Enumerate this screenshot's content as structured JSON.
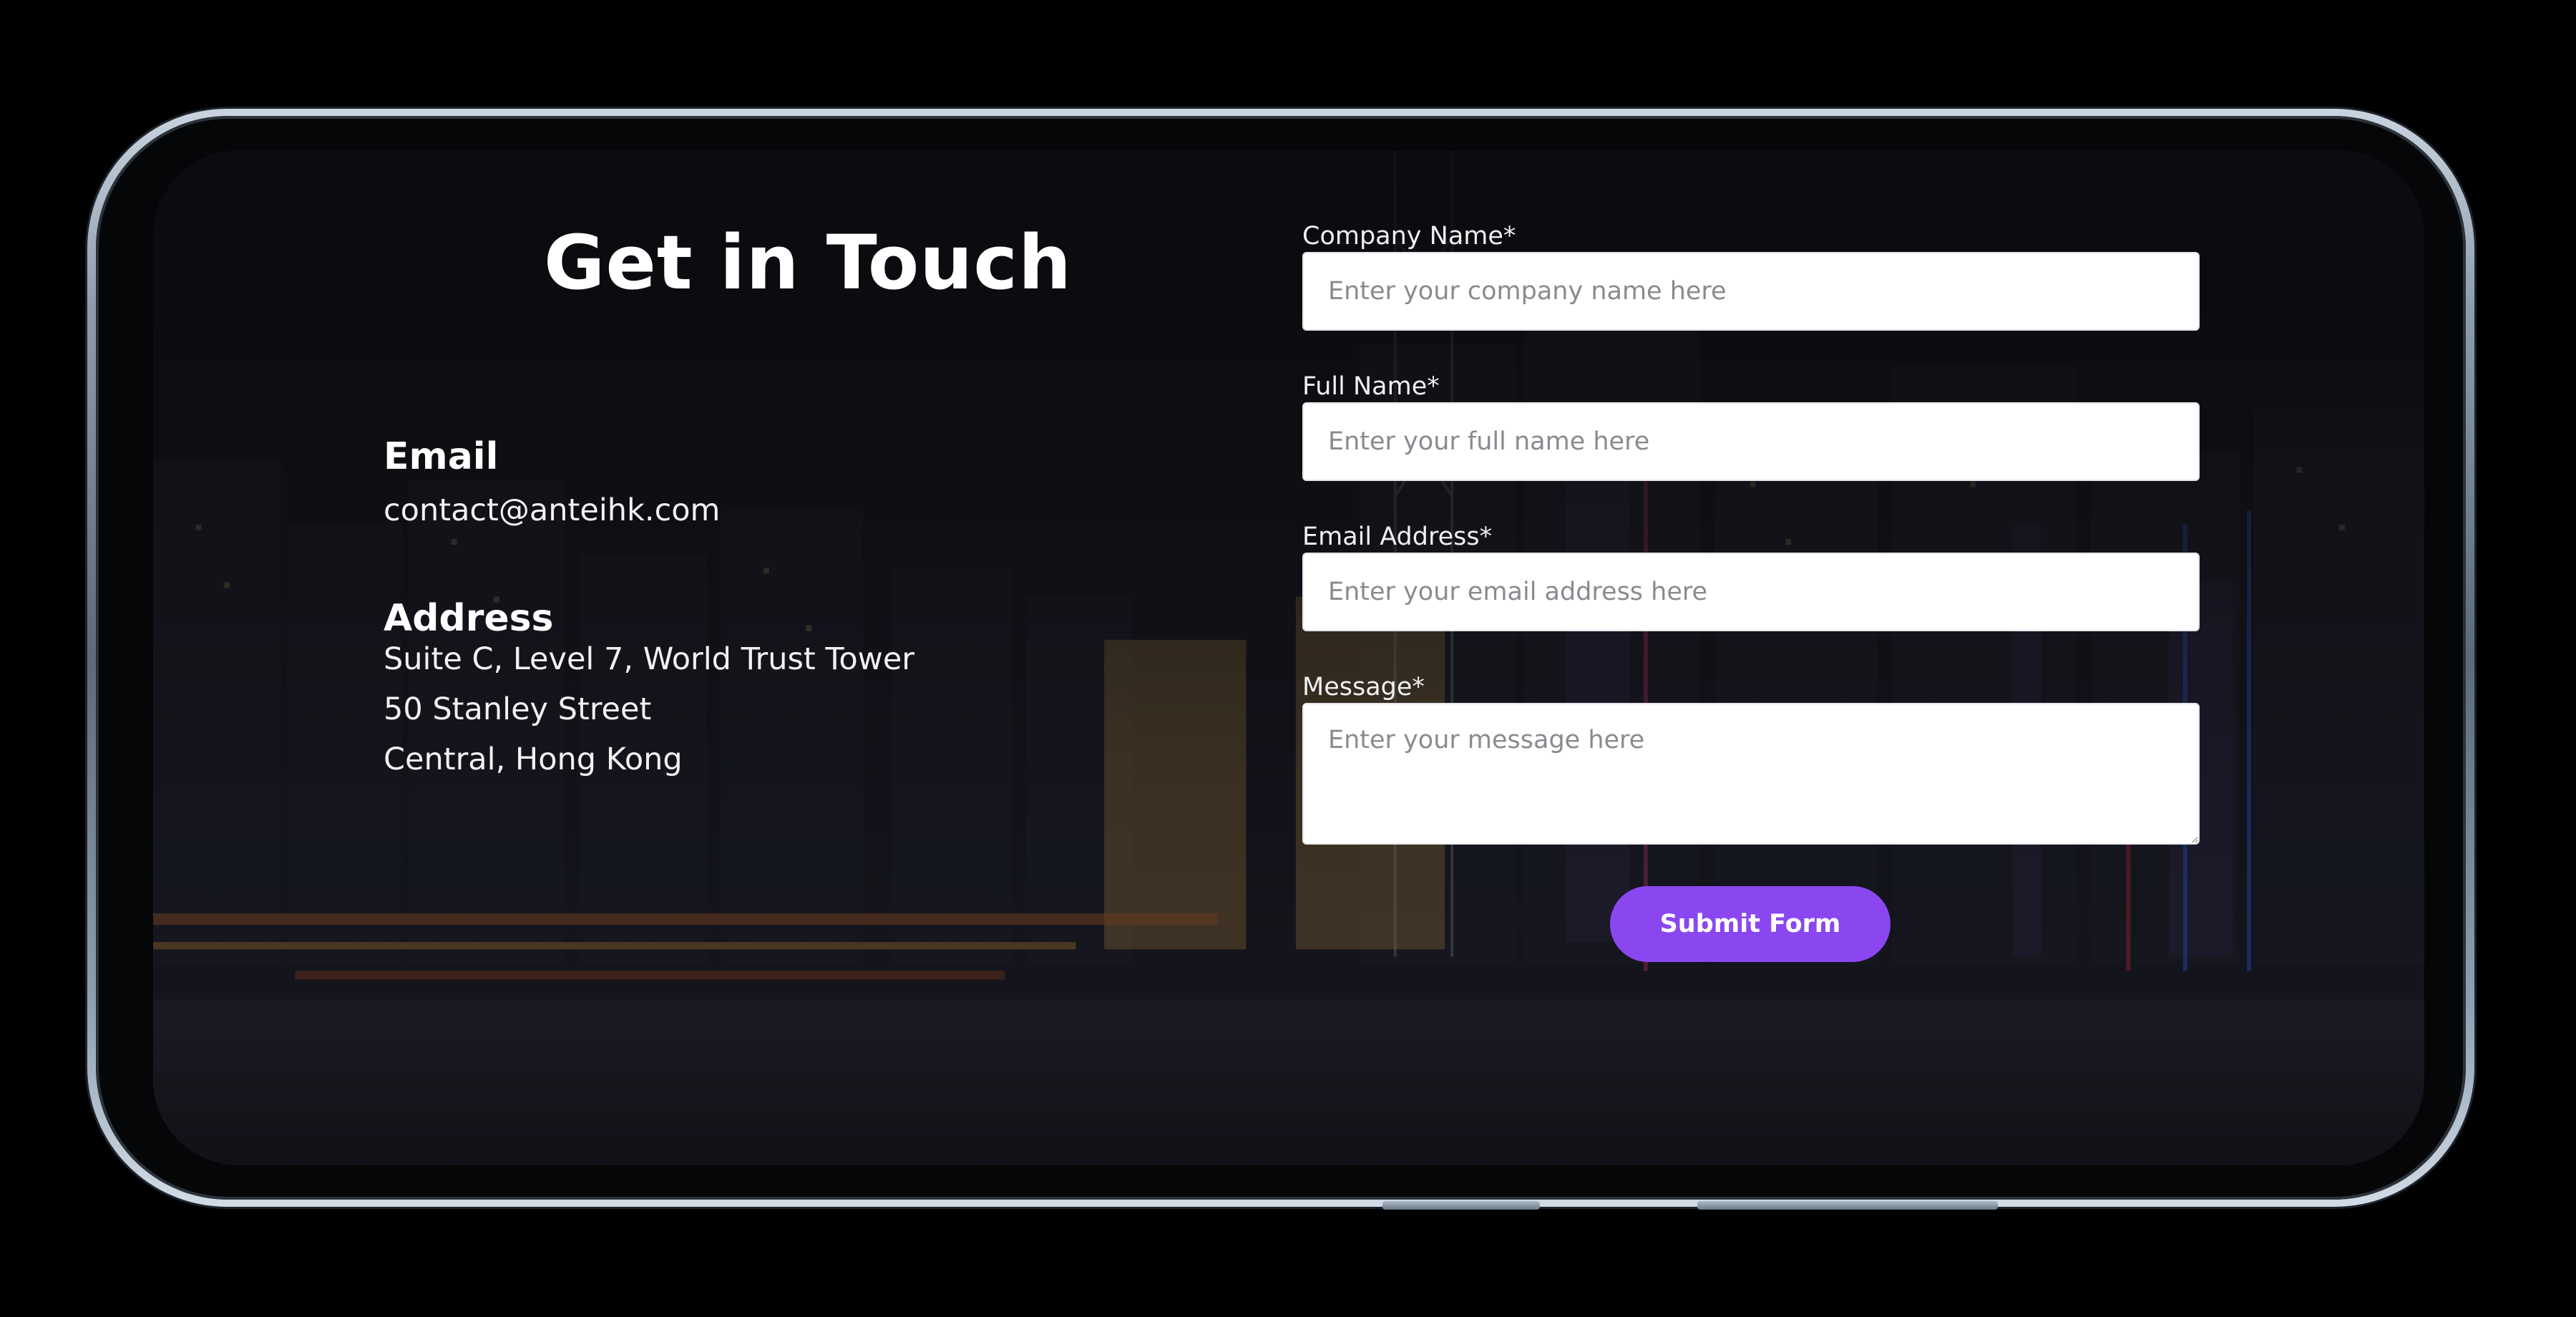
{
  "page": {
    "title": "Get in Touch"
  },
  "contact": {
    "email_heading": "Email",
    "email_value": "contact@anteihk.com",
    "address_heading": "Address",
    "address_lines": [
      "Suite C, Level 7, World Trust Tower",
      "50 Stanley Street",
      "Central, Hong Kong"
    ]
  },
  "form": {
    "company": {
      "label": "Company Name*",
      "placeholder": "Enter your company name here"
    },
    "full_name": {
      "label": "Full Name*",
      "placeholder": "Enter your full name here"
    },
    "email": {
      "label": "Email Address*",
      "placeholder": "Enter your email address here"
    },
    "message": {
      "label": "Message*",
      "placeholder": "Enter your message here"
    },
    "submit_label": "Submit Form"
  },
  "colors": {
    "accent": "#8a47f0",
    "background": "#000000",
    "text": "#ffffff"
  }
}
